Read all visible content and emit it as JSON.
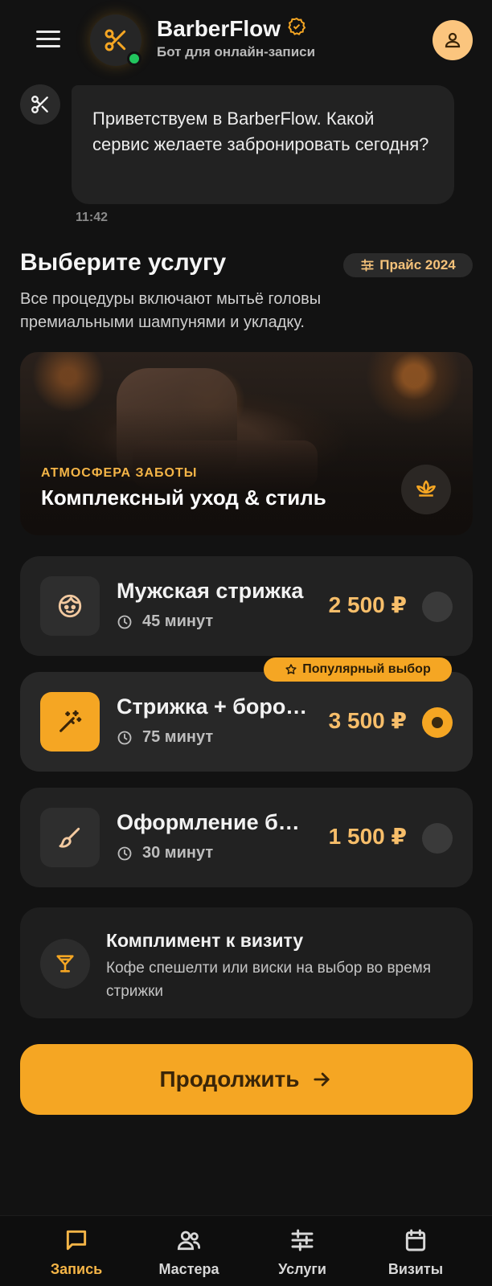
{
  "header": {
    "title": "BarberFlow",
    "subtitle": "Бот для онлайн-записи"
  },
  "chat": {
    "message": "Приветствуем в BarberFlow. Какой сервис желаете забронировать сегодня?",
    "time": "11:42"
  },
  "section": {
    "title": "Выберите услугу",
    "badge": "Прайс 2024",
    "description": "Все процедуры включают мытьё головы премиальными шампунями и укладку."
  },
  "hero": {
    "tag": "АТМОСФЕРА ЗАБОТЫ",
    "title": "Комплексный уход & стиль"
  },
  "services": [
    {
      "name": "Мужская стрижка",
      "duration": "45 минут",
      "price": "2 500 ₽",
      "icon": "face-icon",
      "selected": false
    },
    {
      "name": "Стрижка + борода",
      "duration": "75 минут",
      "price": "3 500 ₽",
      "icon": "magic-wand-icon",
      "selected": true,
      "badge": "Популярный выбор"
    },
    {
      "name": "Оформление бороды",
      "duration": "30 минут",
      "price": "1 500 ₽",
      "icon": "brush-icon",
      "selected": false
    }
  ],
  "compliment": {
    "title": "Комплимент к визиту",
    "description": "Кофе спешелти или виски на выбор во время стрижки",
    "icon": "cocktail-icon"
  },
  "continue_label": "Продолжить",
  "nav": [
    {
      "label": "Запись",
      "icon": "chat-icon",
      "active": true
    },
    {
      "label": "Мастера",
      "icon": "users-icon",
      "active": false
    },
    {
      "label": "Услуги",
      "icon": "sliders-icon",
      "active": false
    },
    {
      "label": "Визиты",
      "icon": "calendar-icon",
      "active": false
    }
  ],
  "colors": {
    "accent": "#f5a623",
    "accent_text": "#f7be6a",
    "background": "#121212",
    "card": "#222222",
    "online": "#22c55e"
  }
}
